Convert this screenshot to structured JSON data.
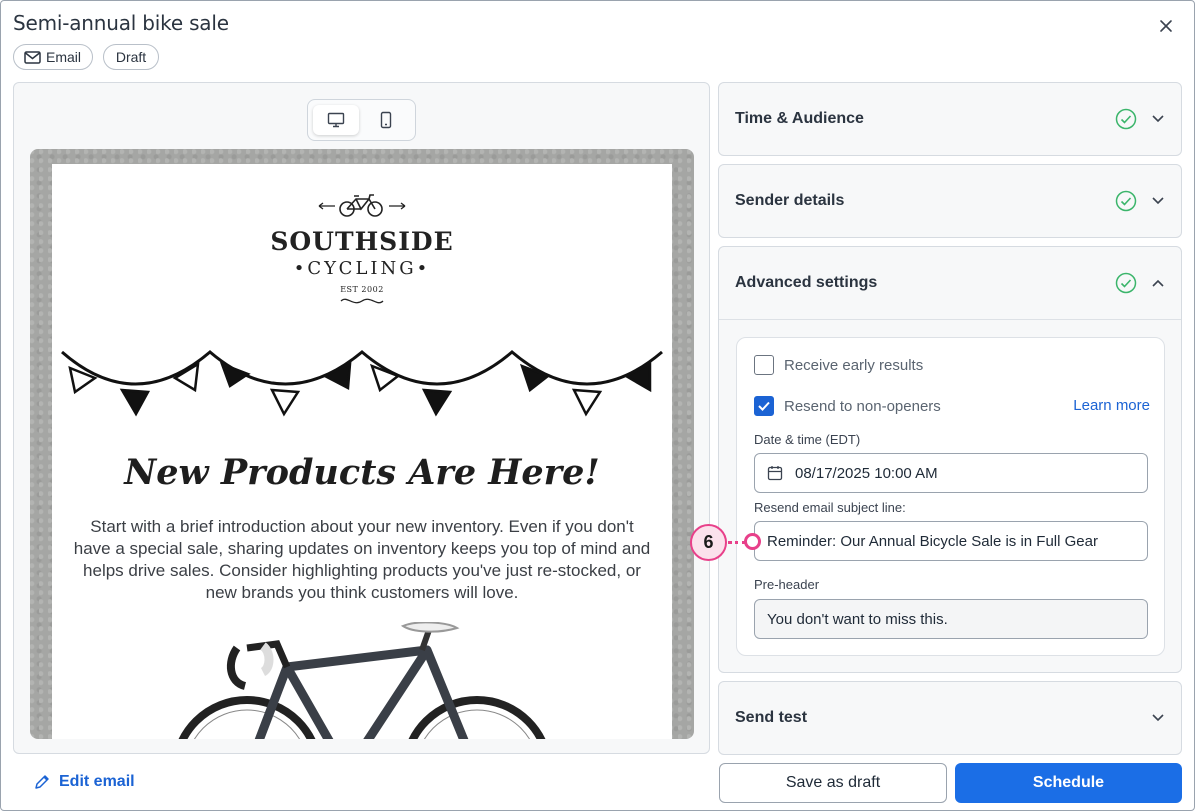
{
  "header": {
    "title": "Semi-annual bike sale",
    "chips": {
      "email": "Email",
      "status": "Draft"
    }
  },
  "preview": {
    "logo": {
      "word": "SOUTHSIDE",
      "sub": "CYCLING",
      "est": "EST 2002"
    },
    "headline": "New Products Are Here!",
    "body": "Start with a brief introduction about your new inventory. Even if you don't have a special sale, sharing updates on inventory keeps you top of mind and helps drive sales. Consider highlighting products you've just re-stocked, or new brands you think customers will love."
  },
  "edit_link": "Edit email",
  "panels": {
    "time_audience": "Time & Audience",
    "sender_details": "Sender details",
    "advanced_settings": "Advanced settings",
    "send_test": "Send test"
  },
  "advanced": {
    "early_results": "Receive early results",
    "resend": "Resend to non-openers",
    "learn_more": "Learn more",
    "date_label": "Date & time (EDT)",
    "date_value": "08/17/2025 10:00 AM",
    "subject_label": "Resend email subject line:",
    "subject_value": "Reminder: Our Annual Bicycle Sale is in Full Gear",
    "preheader_label": "Pre-header",
    "preheader_value": "You don't want to miss this."
  },
  "callout": "6",
  "buttons": {
    "save_draft": "Save as draft",
    "schedule": "Schedule"
  },
  "colors": {
    "primary": "#1b6ee6",
    "link": "#1b63d4",
    "success": "#3bb56b",
    "callout": "#e8408a"
  }
}
